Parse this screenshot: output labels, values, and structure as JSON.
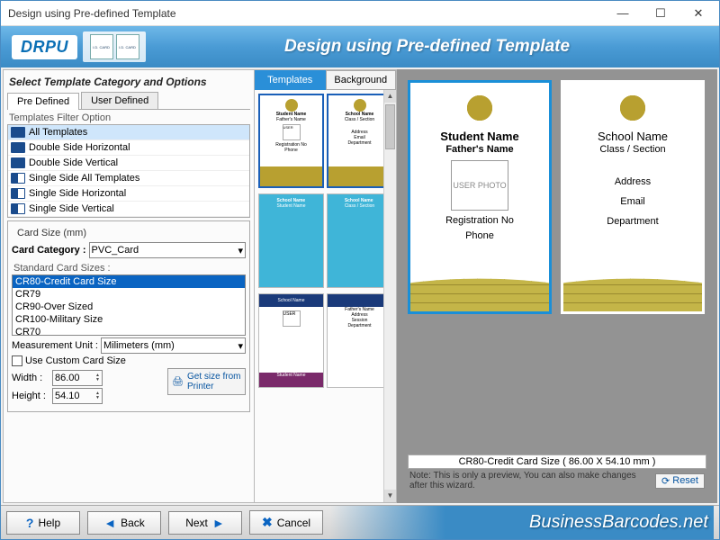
{
  "titlebar": {
    "title": "Design using Pre-defined Template"
  },
  "banner": {
    "logo": "DRPU",
    "title": "Design using Pre-defined Template"
  },
  "left": {
    "section_title": "Select Template Category and Options",
    "tabs": {
      "predefined": "Pre Defined",
      "userdefined": "User Defined"
    },
    "filter_label": "Templates Filter Option",
    "filters": [
      "All Templates",
      "Double Side Horizontal",
      "Double Side Vertical",
      "Single Side All Templates",
      "Single Side Horizontal",
      "Single Side Vertical"
    ],
    "cardsize": {
      "legend": "Card Size (mm)",
      "category_label": "Card Category :",
      "category_value": "PVC_Card",
      "std_label": "Standard Card Sizes :",
      "sizes": [
        "CR80-Credit Card Size",
        "CR79",
        "CR90-Over Sized",
        "CR100-Military Size",
        "CR70"
      ],
      "unit_label": "Measurement Unit :",
      "unit_value": "Milimeters (mm)",
      "custom_label": "Use Custom Card Size",
      "width_label": "Width :",
      "width_value": "86.00",
      "height_label": "Height :",
      "height_value": "54.10",
      "printer_btn": "Get size from Printer"
    }
  },
  "mid": {
    "tabs": {
      "templates": "Templates",
      "background": "Background"
    }
  },
  "preview": {
    "front": {
      "name": "Student Name",
      "sub": "Father's Name",
      "photo": "USER PHOTO",
      "f1": "Registration No",
      "f2": "Phone"
    },
    "back": {
      "name": "School Name",
      "sub": "Class / Section",
      "f1": "Address",
      "f2": "Email",
      "f3": "Department"
    },
    "size_label": "CR80-Credit Card Size ( 86.00 X 54.10 mm )",
    "note": "Note: This is only a preview, You can also make changes after this wizard.",
    "reset": "Reset"
  },
  "footer": {
    "help": "Help",
    "back": "Back",
    "next": "Next",
    "cancel": "Cancel",
    "brand": "BusinessBarcodes.net"
  }
}
